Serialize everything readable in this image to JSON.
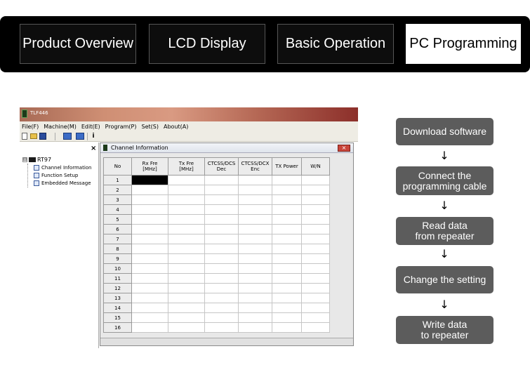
{
  "tabs": [
    {
      "label": "Product Overview",
      "active": false
    },
    {
      "label": "LCD Display",
      "active": false
    },
    {
      "label": "Basic Operation",
      "active": false
    },
    {
      "label": "PC Programming",
      "active": true
    }
  ],
  "software": {
    "app_title": "TLF446",
    "menu": [
      "File(F)",
      "Machine(M)",
      "Edit(E)",
      "Program(P)",
      "Set(S)",
      "About(A)"
    ],
    "toolbar_icons": [
      "new-file-icon",
      "open-folder-icon",
      "save-icon",
      "read-from-radio-icon",
      "write-to-radio-icon",
      "info-icon"
    ],
    "tree": {
      "close": "×",
      "expand": "⊟",
      "root": "RT97",
      "items": [
        "Channel Information",
        "Function Setup",
        "Embedded Message"
      ]
    },
    "child_window": {
      "title": "Channel Information",
      "close": "×",
      "columns": [
        "No",
        "Rx Fre\n[MHz]",
        "Tx Fre\n[MHz]",
        "CTCSS/DCS\nDec",
        "CTCSS/DCX\nEnc",
        "TX Power",
        "W/N"
      ],
      "rows": [
        "1",
        "2",
        "3",
        "4",
        "5",
        "6",
        "7",
        "8",
        "9",
        "10",
        "11",
        "12",
        "13",
        "14",
        "15",
        "16"
      ],
      "selected_cell": {
        "row": 1,
        "column": "Rx Fre [MHz]"
      }
    }
  },
  "flow": {
    "steps": [
      "Download software",
      "Connect the\nprogramming cable",
      "Read data\nfrom repeater",
      "Change the setting",
      "Write data\nto repeater"
    ],
    "arrow": "↓"
  },
  "colors": {
    "tab_bar": "#000000",
    "active_tab": "#ffffff",
    "step_box": "#5c5c5c",
    "title_gradient_end": "#8c2f2a"
  }
}
